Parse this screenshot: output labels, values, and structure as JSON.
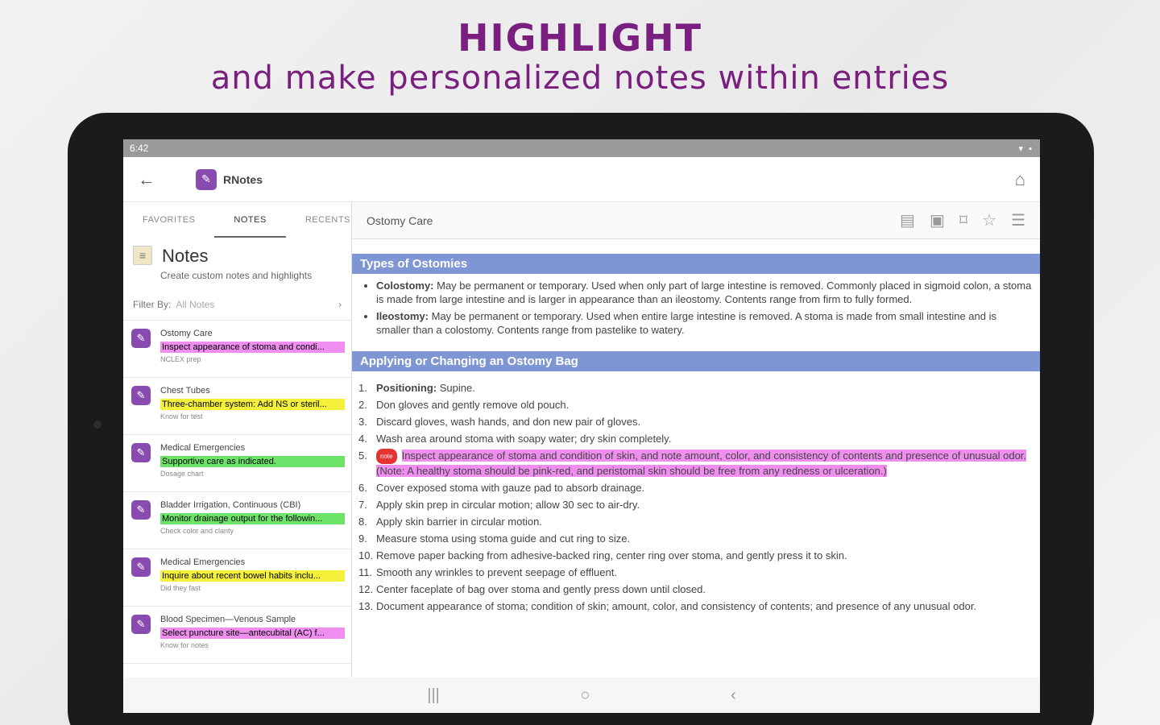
{
  "headline": {
    "title": "HIGHLIGHT",
    "subtitle": "and make personalized notes within entries"
  },
  "status": {
    "time": "6:42",
    "icons": "wifi-icon battery-icon"
  },
  "appbar": {
    "title": "RNotes"
  },
  "tabs": [
    {
      "label": "FAVORITES",
      "active": false
    },
    {
      "label": "NOTES",
      "active": true
    },
    {
      "label": "RECENTS",
      "active": false
    }
  ],
  "notes_panel": {
    "title": "Notes",
    "subtitle": "Create custom notes and highlights",
    "filter_label": "Filter By:",
    "filter_value": "All Notes"
  },
  "notes": [
    {
      "title": "Ostomy Care",
      "highlight": "Inspect appearance of stoma and condi...",
      "color": "pink",
      "tag": "NCLEX prep"
    },
    {
      "title": "Chest Tubes",
      "highlight": "Three-chamber system: Add NS or steril...",
      "color": "yellow",
      "tag": "Know for test"
    },
    {
      "title": "Medical Emergencies",
      "highlight": "Supportive care as indicated.",
      "color": "green",
      "tag": "Dosage chart"
    },
    {
      "title": "Bladder Irrigation, Continuous (CBI)",
      "highlight": "Monitor drainage output for the followin...",
      "color": "green",
      "tag": "Check color and clarity"
    },
    {
      "title": "Medical Emergencies",
      "highlight": "Inquire about recent bowel habits inclu...",
      "color": "yellow",
      "tag": "Did they fast"
    },
    {
      "title": "Blood Specimen—Venous Sample",
      "highlight": "Select puncture site—antecubital (AC) f...",
      "color": "pink",
      "tag": "Know for notes"
    }
  ],
  "topic": {
    "title": "Ostomy Care"
  },
  "sections": {
    "types_title": "Types of Ostomies",
    "types": [
      {
        "term": "Colostomy:",
        "text": "May be permanent or temporary. Used when only part of large intestine is removed. Commonly placed in sigmoid colon, a stoma is made from large intestine and is larger in appearance than an ileostomy. Contents range from firm to fully formed."
      },
      {
        "term": "Ileostomy:",
        "text": "May be permanent or temporary. Used when entire large intestine is removed. A stoma is made from small intestine and is smaller than a colostomy. Contents range from pastelike to watery."
      }
    ],
    "apply_title": "Applying or Changing an Ostomy Bag",
    "steps": [
      {
        "n": "1.",
        "term": "Positioning:",
        "text": "Supine."
      },
      {
        "n": "2.",
        "term": "",
        "text": "Don gloves and gently remove old pouch."
      },
      {
        "n": "3.",
        "term": "",
        "text": "Discard gloves, wash hands, and don new pair of gloves."
      },
      {
        "n": "4.",
        "term": "",
        "text": "Wash area around stoma with soapy water; dry skin completely."
      },
      {
        "n": "5.",
        "term": "",
        "text": "Inspect appearance of stoma and condition of skin, and note amount, color, and consistency of contents and presence of unusual odor. (Note: A healthy stoma should be pink-red, and peristomal skin should be free from any redness or ulceration.)",
        "highlight": true,
        "badge": "note"
      },
      {
        "n": "6.",
        "term": "",
        "text": "Cover exposed stoma with gauze pad to absorb drainage."
      },
      {
        "n": "7.",
        "term": "",
        "text": "Apply skin prep in circular motion; allow 30 sec to air-dry."
      },
      {
        "n": "8.",
        "term": "",
        "text": "Apply skin barrier in circular motion."
      },
      {
        "n": "9.",
        "term": "",
        "text": "Measure stoma using stoma guide and cut ring to size."
      },
      {
        "n": "10.",
        "term": "",
        "text": "Remove paper backing from adhesive-backed ring, center ring over stoma, and gently press it to skin."
      },
      {
        "n": "11.",
        "term": "",
        "text": "Smooth any wrinkles to prevent seepage of effluent."
      },
      {
        "n": "12.",
        "term": "",
        "text": "Center faceplate of bag over stoma and gently press down until closed."
      },
      {
        "n": "13.",
        "term": "",
        "text": "Document appearance of stoma; condition of skin; amount, color, and consistency of contents; and presence of any unusual odor."
      }
    ]
  },
  "colors": {
    "accent": "#7a1f7f",
    "section": "#7f96d4",
    "pink": "#f08ef0",
    "yellow": "#f5f13a",
    "green": "#6de36a"
  }
}
